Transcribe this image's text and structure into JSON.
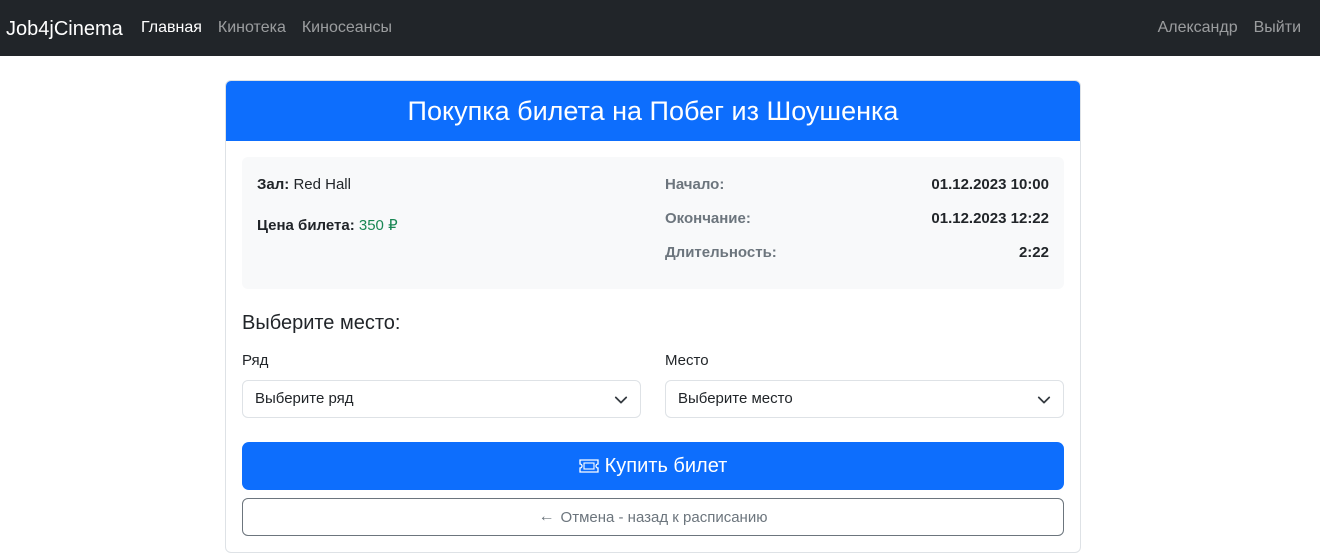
{
  "navbar": {
    "brand": "Job4jCinema",
    "links": [
      {
        "label": "Главная",
        "active": true
      },
      {
        "label": "Кинотека",
        "active": false
      },
      {
        "label": "Киносеансы",
        "active": false
      }
    ],
    "user": "Александр",
    "logout": "Выйти"
  },
  "card": {
    "title": "Покупка билета на Побег из Шоушенка",
    "hall_label": "Зал:",
    "hall_value": "Red Hall",
    "price_label": "Цена билета:",
    "price_value": "350 ₽",
    "start_label": "Начало:",
    "start_value": "01.12.2023 10:00",
    "end_label": "Окончание:",
    "end_value": "01.12.2023 12:22",
    "duration_label": "Длительность:",
    "duration_value": "2:22"
  },
  "form": {
    "choose_title": "Выберите место:",
    "row_label": "Ряд",
    "row_value": "Выберите ряд",
    "seat_label": "Место",
    "seat_value": "Выберите место",
    "buy_label": "Купить билет",
    "cancel_label": "Отмена - назад к расписанию"
  },
  "colors": {
    "primary": "#0d6efd",
    "navbar": "#212529",
    "price": "#198754"
  },
  "icons": [
    "ticket-icon",
    "arrow-left-icon",
    "chevron-down-icon"
  ]
}
